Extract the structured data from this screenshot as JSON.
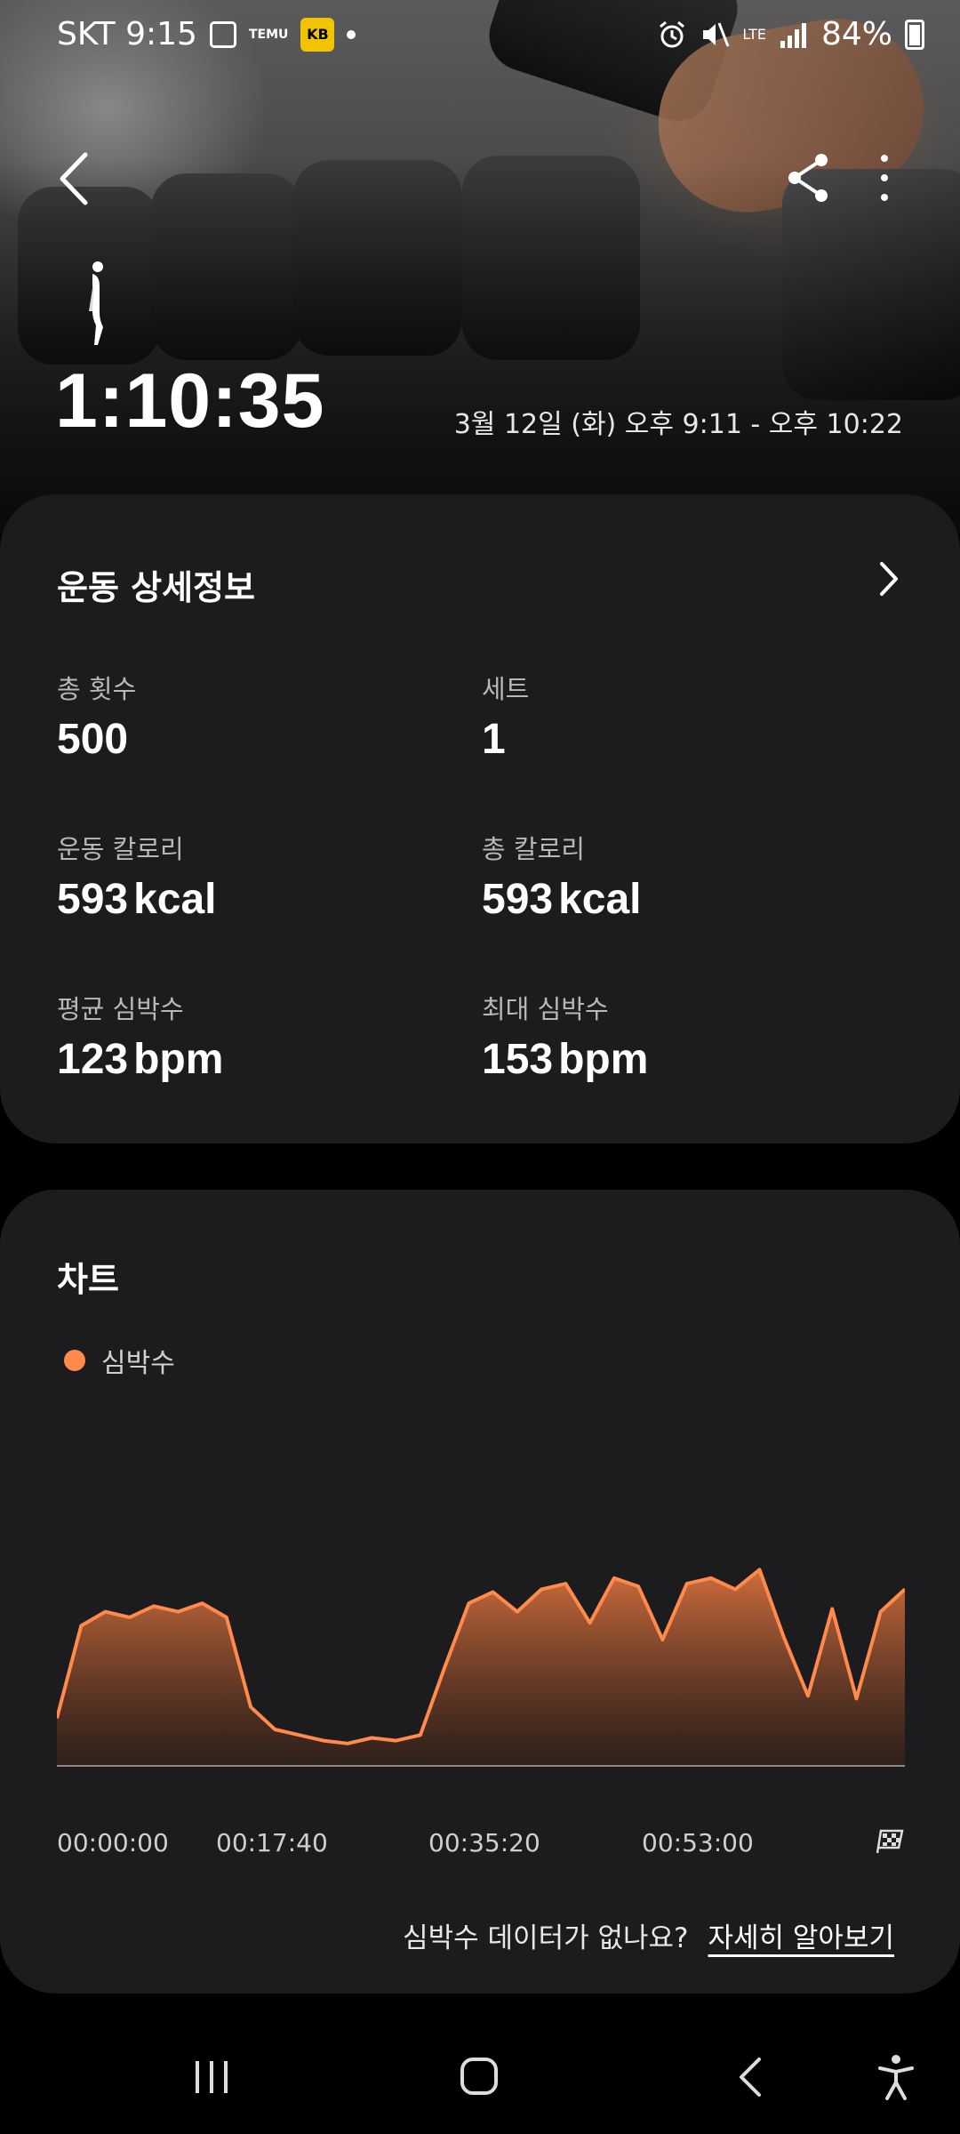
{
  "status": {
    "carrier_time": "SKT 9:15",
    "temu_label": "TEMU",
    "kb_label": "KB",
    "network": "LTE",
    "battery": "84%"
  },
  "hero": {
    "duration": "1:10:35",
    "date_range": "3월 12일 (화) 오후 9:11 - 오후 10:22"
  },
  "details": {
    "title": "운동 상세정보",
    "stats": [
      {
        "label": "총 횟수",
        "value": "500",
        "unit": ""
      },
      {
        "label": "세트",
        "value": "1",
        "unit": ""
      },
      {
        "label": "운동 칼로리",
        "value": "593",
        "unit": "kcal"
      },
      {
        "label": "총 칼로리",
        "value": "593",
        "unit": "kcal"
      },
      {
        "label": "평균 심박수",
        "value": "123",
        "unit": "bpm"
      },
      {
        "label": "최대 심박수",
        "value": "153",
        "unit": "bpm"
      }
    ]
  },
  "chart": {
    "title": "차트",
    "legend": "심박수",
    "help_question": "심박수 데이터가 없나요?",
    "help_link": "자세히 알아보기"
  },
  "colors": {
    "accent": "#ff8a4c",
    "card": "#1c1c1e",
    "background": "#000000"
  },
  "chart_data": {
    "type": "area",
    "series": [
      {
        "name": "심박수",
        "x": [
          "00:00",
          "00:02",
          "00:04",
          "00:06",
          "00:08",
          "00:10",
          "00:12",
          "00:14",
          "00:16",
          "00:18",
          "00:20",
          "00:22",
          "00:24",
          "00:26",
          "00:28",
          "00:30",
          "00:32",
          "00:34",
          "00:36",
          "00:38",
          "00:40",
          "00:42",
          "00:44",
          "00:46",
          "00:48",
          "00:50",
          "00:52",
          "00:54",
          "00:56",
          "00:58",
          "01:00",
          "01:02",
          "01:04",
          "01:06",
          "01:08",
          "01:10"
        ],
        "values": [
          92,
          125,
          130,
          128,
          132,
          130,
          133,
          128,
          96,
          88,
          86,
          84,
          83,
          85,
          84,
          86,
          110,
          133,
          137,
          130,
          138,
          140,
          126,
          142,
          139,
          120,
          140,
          142,
          138,
          145,
          121,
          100,
          131,
          99,
          130,
          138
        ]
      }
    ],
    "xtick_labels": [
      "00:00:00",
      "00:17:40",
      "00:35:20",
      "00:53:00"
    ],
    "ylim": [
      75,
      160
    ],
    "grid": false
  }
}
